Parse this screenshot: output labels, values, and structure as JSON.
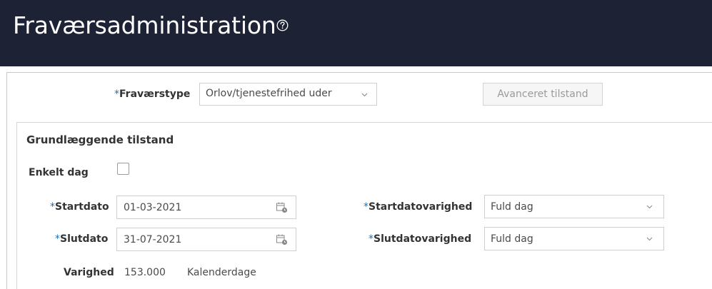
{
  "header": {
    "title": "Fraværsadministration",
    "help_icon": "help-circle-icon",
    "background": "#1e2235"
  },
  "form": {
    "absence_type": {
      "label": "Fraværstype",
      "required_marker": "*",
      "value": "Orlov/tjenestefrihed uder"
    },
    "advanced_button": {
      "label": "Avanceret tilstand"
    }
  },
  "basic": {
    "title": "Grundlæggende tilstand",
    "single_day": {
      "label": "Enkelt dag",
      "checked": false
    },
    "start_date": {
      "label": "Startdato",
      "required_marker": "*",
      "value": "01-03-2021",
      "icon": "calendar-icon"
    },
    "end_date": {
      "label": "Slutdato",
      "required_marker": "*",
      "value": "31-07-2021",
      "icon": "calendar-icon"
    },
    "start_duration": {
      "label": "Startdatovarighed",
      "required_marker": "*",
      "value": "Fuld dag"
    },
    "end_duration": {
      "label": "Slutdatovarighed",
      "required_marker": "*",
      "value": "Fuld dag"
    },
    "duration": {
      "label": "Varighed",
      "value": "153.000",
      "unit": "Kalenderdage"
    }
  },
  "colors": {
    "required": "#1a6fb5",
    "disabled_text": "#9a9a9a"
  }
}
